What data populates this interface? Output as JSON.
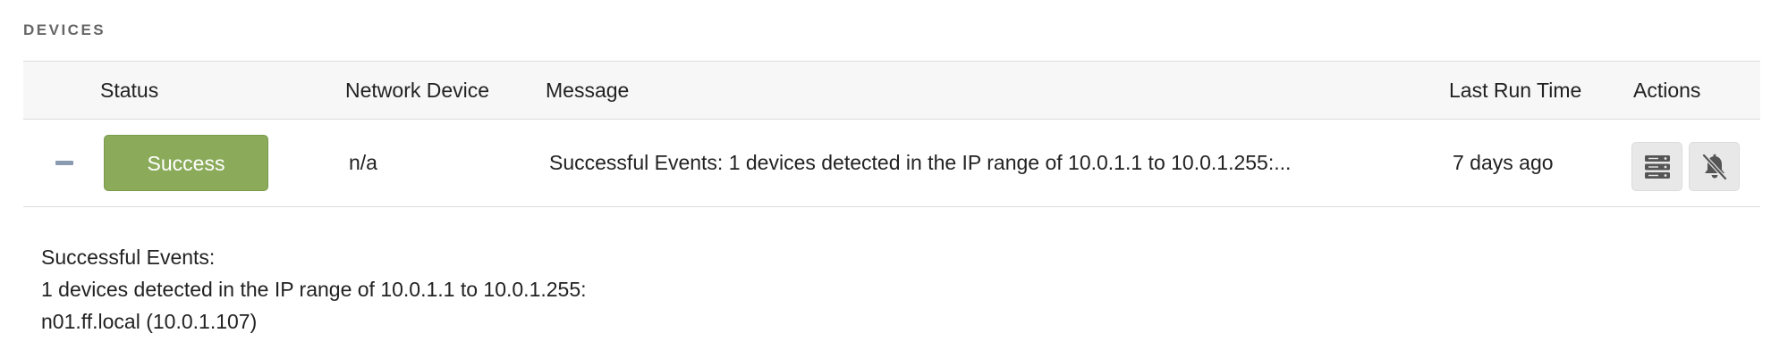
{
  "section": {
    "title": "DEVICES"
  },
  "table": {
    "columns": {
      "status": "Status",
      "network_device": "Network Device",
      "message": "Message",
      "last_run_time": "Last Run Time",
      "actions": "Actions"
    },
    "rows": [
      {
        "status": "Success",
        "network_device": "n/a",
        "message": "Successful Events: 1 devices detected in the IP range of 10.0.1.1 to 10.0.1.255:...",
        "last_run_time": "7 days ago",
        "actions": [
          "server-icon",
          "bell-slash-icon"
        ]
      }
    ]
  },
  "details": {
    "lines": [
      "Successful Events:",
      "1 devices detected in the IP range of 10.0.1.1 to 10.0.1.255:",
      "n01.ff.local (10.0.1.107)"
    ]
  },
  "colors": {
    "success": "#8bab5b",
    "header_bg": "#f7f7f7",
    "border": "#dddddd",
    "action_bg": "#e8e8e8",
    "icon": "#555555",
    "toggle": "#8a9bb0"
  }
}
